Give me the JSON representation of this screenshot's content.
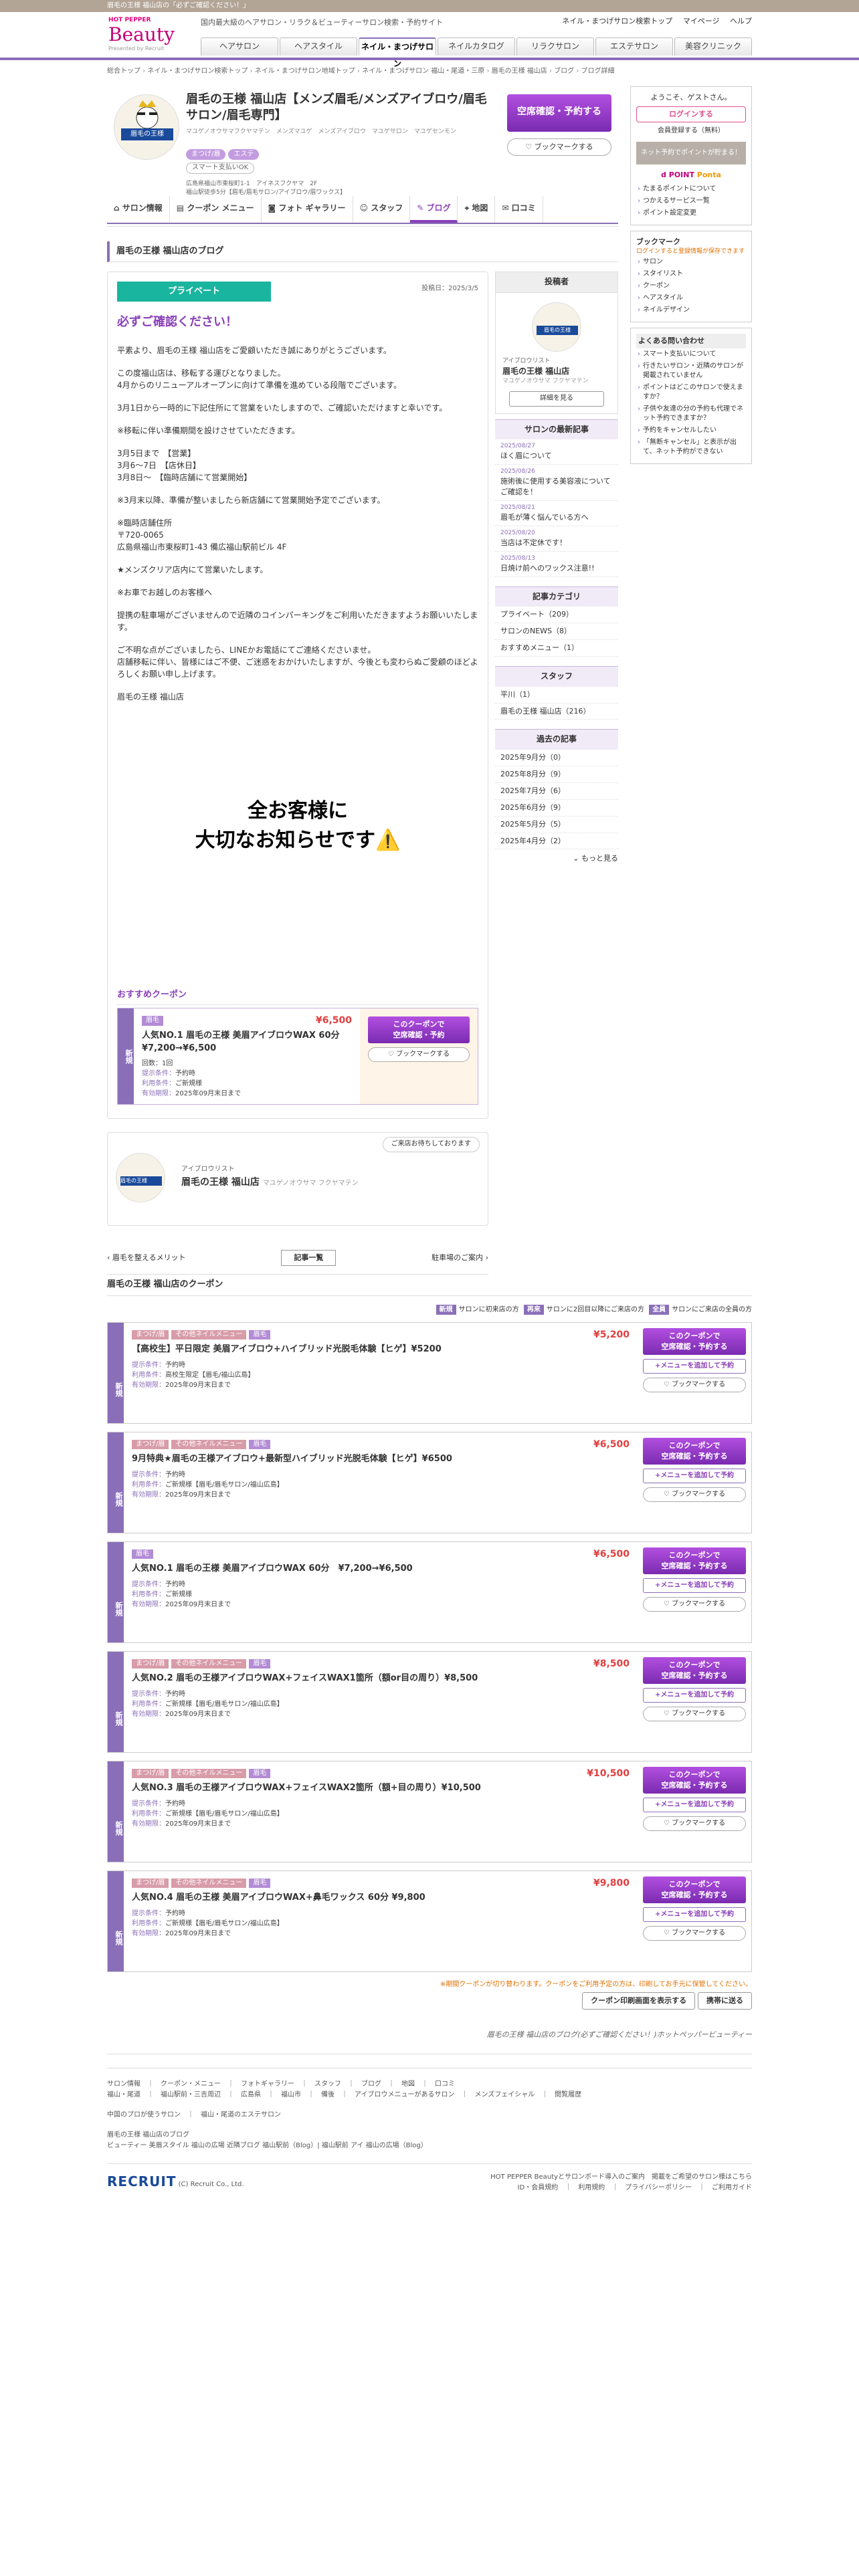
{
  "top_notice": "眉毛の王様 福山店の「必ずご確認ください！」",
  "header": {
    "brand_small": "HOT PEPPER",
    "brand": "Beauty",
    "powered": "Presented by Recruit",
    "tagline": "国内最大級のヘアサロン・リラク＆ビューティーサロン検索・予約サイト",
    "links": [
      "ネイル・まつげサロン検索トップ",
      "マイページ",
      "ヘルプ"
    ],
    "nav": [
      "ヘアサロン",
      "ヘアスタイル",
      "ネイル・まつげサロン",
      "ネイルカタログ",
      "リラクサロン",
      "エステサロン",
      "美容クリニック"
    ]
  },
  "breadcrumb": [
    "総合トップ",
    "ネイル・まつげサロン検索トップ",
    "ネイル・まつげサロン地域トップ",
    "ネイル・まつげサロン 福山・尾道・三原",
    "眉毛の王様 福山店",
    "ブログ",
    "ブログ詳細"
  ],
  "salon": {
    "name": "眉毛の王様 福山店【メンズ眉毛/メンズアイブロウ/眉毛サロン/眉毛専門】",
    "kana": "マユゲノオウサマフクヤマテン　メンズマユゲ　メンズアイブロウ　マユゲサロン　マユゲセンモン",
    "logo_text": "眉毛の王様",
    "badges": [
      "まつげ/眉",
      "エステ"
    ],
    "smart_pay": "スマート支払いOK",
    "address1": "広島県福山市東桜町1-1　アイネスフクヤマ　2F",
    "address2": "福山駅徒歩5分【眉毛/眉毛サロン/アイブロウ/眉ワックス】",
    "book_label": "空席確認・予約する",
    "bookmark_label": "ブックマークする"
  },
  "tabs": [
    "サロン情報",
    "クーポン メニュー",
    "フォト ギャラリー",
    "スタッフ",
    "ブログ",
    "地図",
    "口コミ"
  ],
  "blog_heading": "眉毛の王様 福山店のブログ",
  "post": {
    "tag": "プライベート",
    "date": "投稿日：2025/3/5",
    "title": "必ずご確認ください！",
    "paragraphs": [
      "平素より、眉毛の王様 福山店をご愛顧いただき誠にありがとうございます。",
      "この度福山店は、移転する運びとなりました。\n4月からのリニューアルオープンに向けて準備を進めている段階でございます。",
      "3月1日から一時的に下記住所にて営業をいたしますので、ご確認いただけますと幸いです。",
      "※移転に伴い準備期間を設けさせていただきます。",
      "3月5日まで　【営業】\n3月6～7日　【店休日】\n3月8日～　【臨時店舗にて営業開始】",
      "※3月末以降、準備が整いましたら新店舗にて営業開始予定でございます。",
      "※臨時店舗住所\n〒720-0065\n広島県福山市東桜町1-43 備広福山駅前ビル 4F",
      "★メンズクリア店内にて営業いたします。",
      "※お車でお越しのお客様へ",
      "提携の駐車場がございませんので近隣のコインパーキングをご利用いただきますようお願いいたします。",
      "ご不明な点がございましたら、LINEかお電話にてご連絡くださいませ。\n店舗移転に伴い、皆様にはご不便、ご迷惑をおかけいたしますが、今後とも変わらぬご愛顧のほどよろしくお願い申し上げます。",
      "眉毛の王様 福山店"
    ],
    "image_text1": "全お客様に",
    "image_text2": "大切なお知らせです⚠️"
  },
  "recommend": {
    "heading": "おすすめクーポン",
    "side": "新規",
    "tag": "眉毛",
    "price": "¥6,500",
    "name": "人気NO.1 眉毛の王様 美眉アイブロウWAX 60分　¥7,200→¥6,500",
    "count": "回数：1回",
    "cond_label": "提示条件：",
    "cond": "予約時",
    "use_label": "利用条件：",
    "use": "ご新規様",
    "exp_label": "有効期限：",
    "exp": "2025年09月末日まで",
    "btn": "このクーポンで\n空席確認・予約",
    "mark": "ブックマークする"
  },
  "author_card": {
    "bubble": "ご来店お待ちしております",
    "role": "アイブロウリスト",
    "name": "眉毛の王様 福山店",
    "kana": "マユゲノオウサマ フクヤマテン"
  },
  "pager": {
    "prev": "眉毛を整えるメリット",
    "list": "記事一覧",
    "next": "駐車場のご案内"
  },
  "sidebar": {
    "poster_title": "投稿者",
    "poster_role": "アイブロウリスト",
    "poster_name": "眉毛の王様 福山店",
    "poster_kana": "マユゲノオウサマ フクヤマテン",
    "poster_btn": "詳細を見る",
    "latest_title": "サロンの最新記事",
    "latest": [
      {
        "d": "2025/08/27",
        "t": "ほく眉について"
      },
      {
        "d": "2025/08/26",
        "t": "施術後に使用する美容液についてご確認を！"
      },
      {
        "d": "2025/08/21",
        "t": "眉毛が薄く悩んでいる方へ"
      },
      {
        "d": "2025/08/20",
        "t": "当店は不定休です！"
      },
      {
        "d": "2025/08/13",
        "t": "日焼け前へのワックス注意!!"
      }
    ],
    "cat_title": "記事カテゴリ",
    "cats": [
      "プライベート（209）",
      "サロンのNEWS（8）",
      "おすすめメニュー（1）"
    ],
    "staff_title": "スタッフ",
    "staff": [
      "平川（1）",
      "眉毛の王様 福山店（216）"
    ],
    "arch_title": "過去の記事",
    "archives": [
      "2025年9月分（0）",
      "2025年8月分（9）",
      "2025年7月分（6）",
      "2025年6月分（9）",
      "2025年5月分（5）",
      "2025年4月分（2）"
    ],
    "more": "もっと見る"
  },
  "right": {
    "welcome": "ようこそ、ゲストさん。",
    "login": "ログインする",
    "register": "会員登録する（無料）",
    "points_text": "ネット予約でポイントが貯まる！",
    "point_links": [
      "たまるポイントについて",
      "つかえるサービス一覧",
      "ポイント設定変更"
    ],
    "bookmark_title": "ブックマーク",
    "bookmark_note": "ログインすると登録情報が保存できます",
    "bookmark_items": [
      "サロン",
      "スタイリスト",
      "クーポン",
      "ヘアスタイル",
      "ネイルデザイン"
    ],
    "faq_title": "よくある問い合わせ",
    "faq": [
      "スマート支払いについて",
      "行きたいサロン・近隣のサロンが掲載されていません",
      "ポイントはどこのサロンで使えますか？",
      "子供や友達の分の予約も代理でネット予約できますか？",
      "予約をキャンセルしたい",
      "「無断キャンセル」と表示が出て、ネット予約ができない"
    ]
  },
  "coupons": {
    "heading": "眉毛の王様 福山店のクーポン",
    "legend": [
      {
        "k": "新規",
        "v": "サロンに初来店の方"
      },
      {
        "k": "再来",
        "v": "サロンに2回目以降にご来店の方"
      },
      {
        "k": "全員",
        "v": "サロンにご来店の全員の方"
      }
    ],
    "items": [
      {
        "tags": [
          "まつげ/眉",
          "その他ネイルメニュー",
          "眉毛"
        ],
        "price": "¥5,200",
        "name": "【高校生】平日限定 美眉アイブロウ+ハイブリッド光脱毛体験【ヒゲ】¥5200",
        "cond": "予約時",
        "use": "高校生限定【眉毛/福山広島】",
        "exp": "2025年09月末日まで"
      },
      {
        "tags": [
          "まつげ/眉",
          "その他ネイルメニュー",
          "眉毛"
        ],
        "price": "¥6,500",
        "name": "9月特典★眉毛の王様アイブロウ+最新型ハイブリッド光脱毛体験【ヒゲ】¥6500",
        "cond": "予約時",
        "use": "ご新規様【眉毛/眉毛サロン/福山広島】",
        "exp": "2025年09月末日まで"
      },
      {
        "tags": [
          "眉毛"
        ],
        "price": "¥6,500",
        "name": "人気NO.1 眉毛の王様 美眉アイブロウWAX 60分　¥7,200→¥6,500",
        "cond": "予約時",
        "use": "ご新規様",
        "exp": "2025年09月末日まで"
      },
      {
        "tags": [
          "まつげ/眉",
          "その他ネイルメニュー",
          "眉毛"
        ],
        "price": "¥8,500",
        "name": "人気NO.2 眉毛の王様アイブロウWAX+フェイスWAX1箇所（額or目の周り）¥8,500",
        "cond": "予約時",
        "use": "ご新規様【眉毛/眉毛サロン/福山広島】",
        "exp": "2025年09月末日まで"
      },
      {
        "tags": [
          "まつげ/眉",
          "その他ネイルメニュー",
          "眉毛"
        ],
        "price": "¥10,500",
        "name": "人気NO.3 眉毛の王様アイブロウWAX+フェイスWAX2箇所（額+目の周り）¥10,500",
        "cond": "予約時",
        "use": "ご新規様【眉毛/眉毛サロン/福山広島】",
        "exp": "2025年09月末日まで"
      },
      {
        "tags": [
          "まつげ/眉",
          "その他ネイルメニュー",
          "眉毛"
        ],
        "price": "¥9,800",
        "name": "人気NO.4 眉毛の王様 美眉アイブロウWAX+鼻毛ワックス 60分 ¥9,800",
        "cond": "予約時",
        "use": "ご新規様【眉毛/眉毛サロン/福山広島】",
        "exp": "2025年09月末日まで"
      }
    ],
    "side": "新規",
    "btn": "このクーポンで\n空席確認・予約する",
    "menu_btn": "+メニューを追加して予約",
    "mark": "ブックマークする",
    "note": "※期間クーポンが切り替わります。クーポンをご利用予定の方は、印刷してお手元に保管してください。",
    "print": "クーポン印刷画面を表示する",
    "pick": "携帯に送る"
  },
  "page_caption": "眉毛の王様 福山店のブログ(必ずご確認ください！)ホットペッパービューティー",
  "footer": {
    "links1": "サロン情報　｜　クーポン・メニュー　｜　フォトギャラリー　｜　スタッフ　｜　ブログ　｜　地図　｜　口コミ",
    "links2": "福山・尾道　｜　福山駅前・三吉周辺　｜　広島県　｜　福山市　｜　備後　｜　アイブロウメニューがあるサロン　｜　メンズフェイシャル　｜　閲覧履歴",
    "links3": "中国のプロが使うサロン　｜　福山・尾道のエステサロン",
    "salon_line": "眉毛の王様 福山店のブログ",
    "salon_sub": "ビューティー 美眉スタイル 福山の広場 近隣ブログ 福山駅前（Blog）| 福山駅前 アイ 福山の広場（Blog）",
    "corp": "RECRUIT",
    "copyright": "(C) Recruit Co., Ltd.",
    "cta": "HOT PEPPER Beautyとサロンボード導入のご案内　掲載をご希望のサロン様はこちら",
    "bottom": "ID・会員規約　｜　利用規約　｜　プライバシーポリシー　｜　ご利用ガイド"
  }
}
